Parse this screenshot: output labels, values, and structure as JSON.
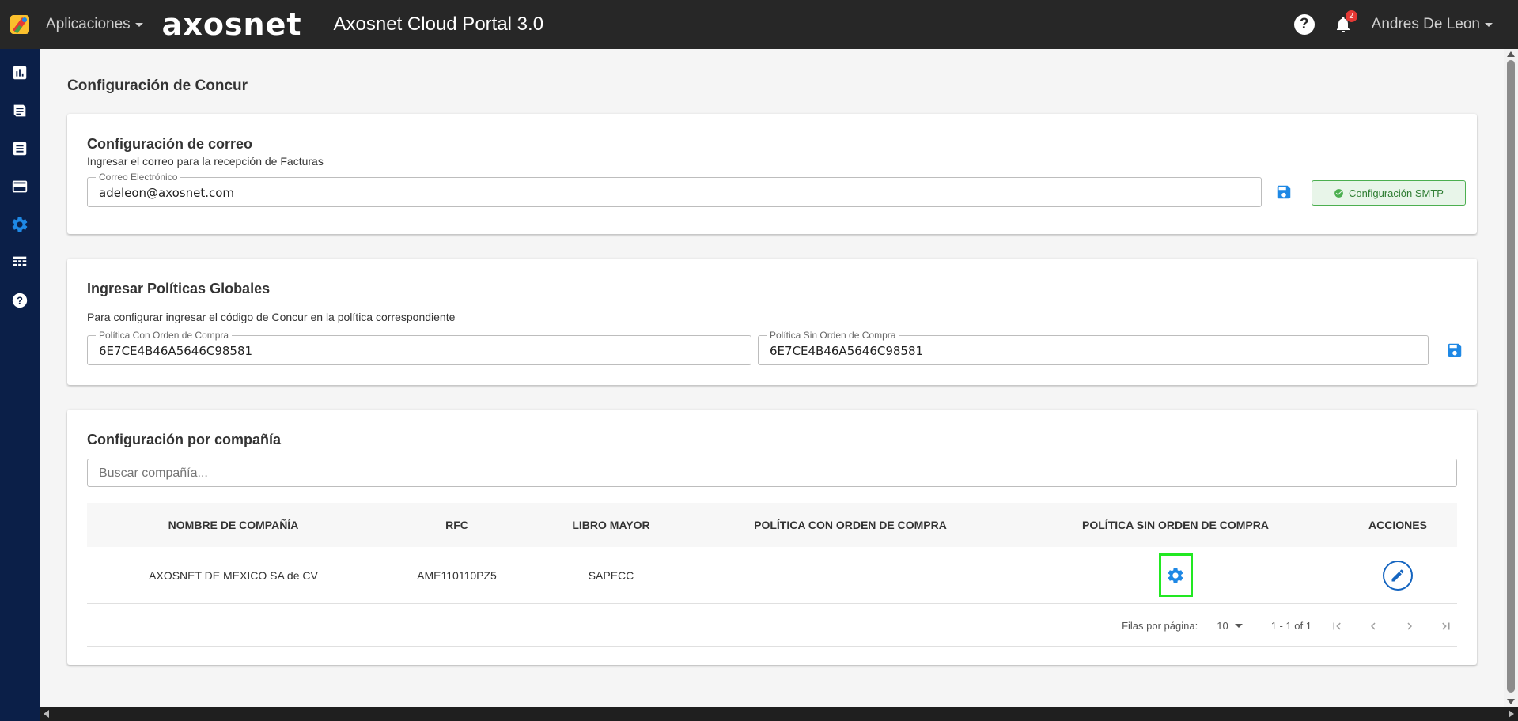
{
  "topbar": {
    "apps_label": "Aplicaciones",
    "brand": "axosnet",
    "portal_title": "Axosnet Cloud Portal 3.0",
    "help_symbol": "?",
    "notification_count": "2",
    "user_name": "Andres De Leon"
  },
  "sidebar": {
    "items": [
      {
        "icon": "chart-icon"
      },
      {
        "icon": "receipt-icon"
      },
      {
        "icon": "document-icon"
      },
      {
        "icon": "credit-card-icon"
      },
      {
        "icon": "gear-icon",
        "active": true
      },
      {
        "icon": "table-icon"
      },
      {
        "icon": "help-icon"
      }
    ]
  },
  "page": {
    "title": "Configuración de Concur"
  },
  "email_config": {
    "title": "Configuración de correo",
    "subtitle": "Ingresar el correo para la recepción de Facturas",
    "field_label": "Correo Electrónico",
    "field_value": "adeleon@axosnet.com",
    "smtp_label": "Configuración SMTP"
  },
  "global_policies": {
    "title": "Ingresar Políticas Globales",
    "subtitle": "Para configurar ingresar el código de Concur en la política correspondiente",
    "with_po_label": "Política Con Orden de Compra",
    "with_po_value": "6E7CE4B46A5646C98581",
    "without_po_label": "Política Sin Orden de Compra",
    "without_po_value": "6E7CE4B46A5646C98581"
  },
  "company_config": {
    "title": "Configuración por compañía",
    "search_placeholder": "Buscar compañía...",
    "columns": [
      "NOMBRE DE COMPAÑÍA",
      "RFC",
      "LIBRO MAYOR",
      "POLÍTICA CON ORDEN DE COMPRA",
      "POLÍTICA SIN ORDEN DE COMPRA",
      "ACCIONES"
    ],
    "rows": [
      {
        "company": "AXOSNET DE MEXICO SA de CV",
        "rfc": "AME110110PZ5",
        "ledger": "SAPECC",
        "with_po": "",
        "without_po": ""
      }
    ],
    "pagination": {
      "rows_per_page_label": "Filas por página:",
      "rows_per_page": "10",
      "range": "1 - 1 of 1"
    }
  },
  "colors": {
    "topbar": "#272727",
    "sidebar": "#0b1f48",
    "accent": "#1e88e5",
    "success": "#4caf50",
    "highlight": "#22e822"
  }
}
